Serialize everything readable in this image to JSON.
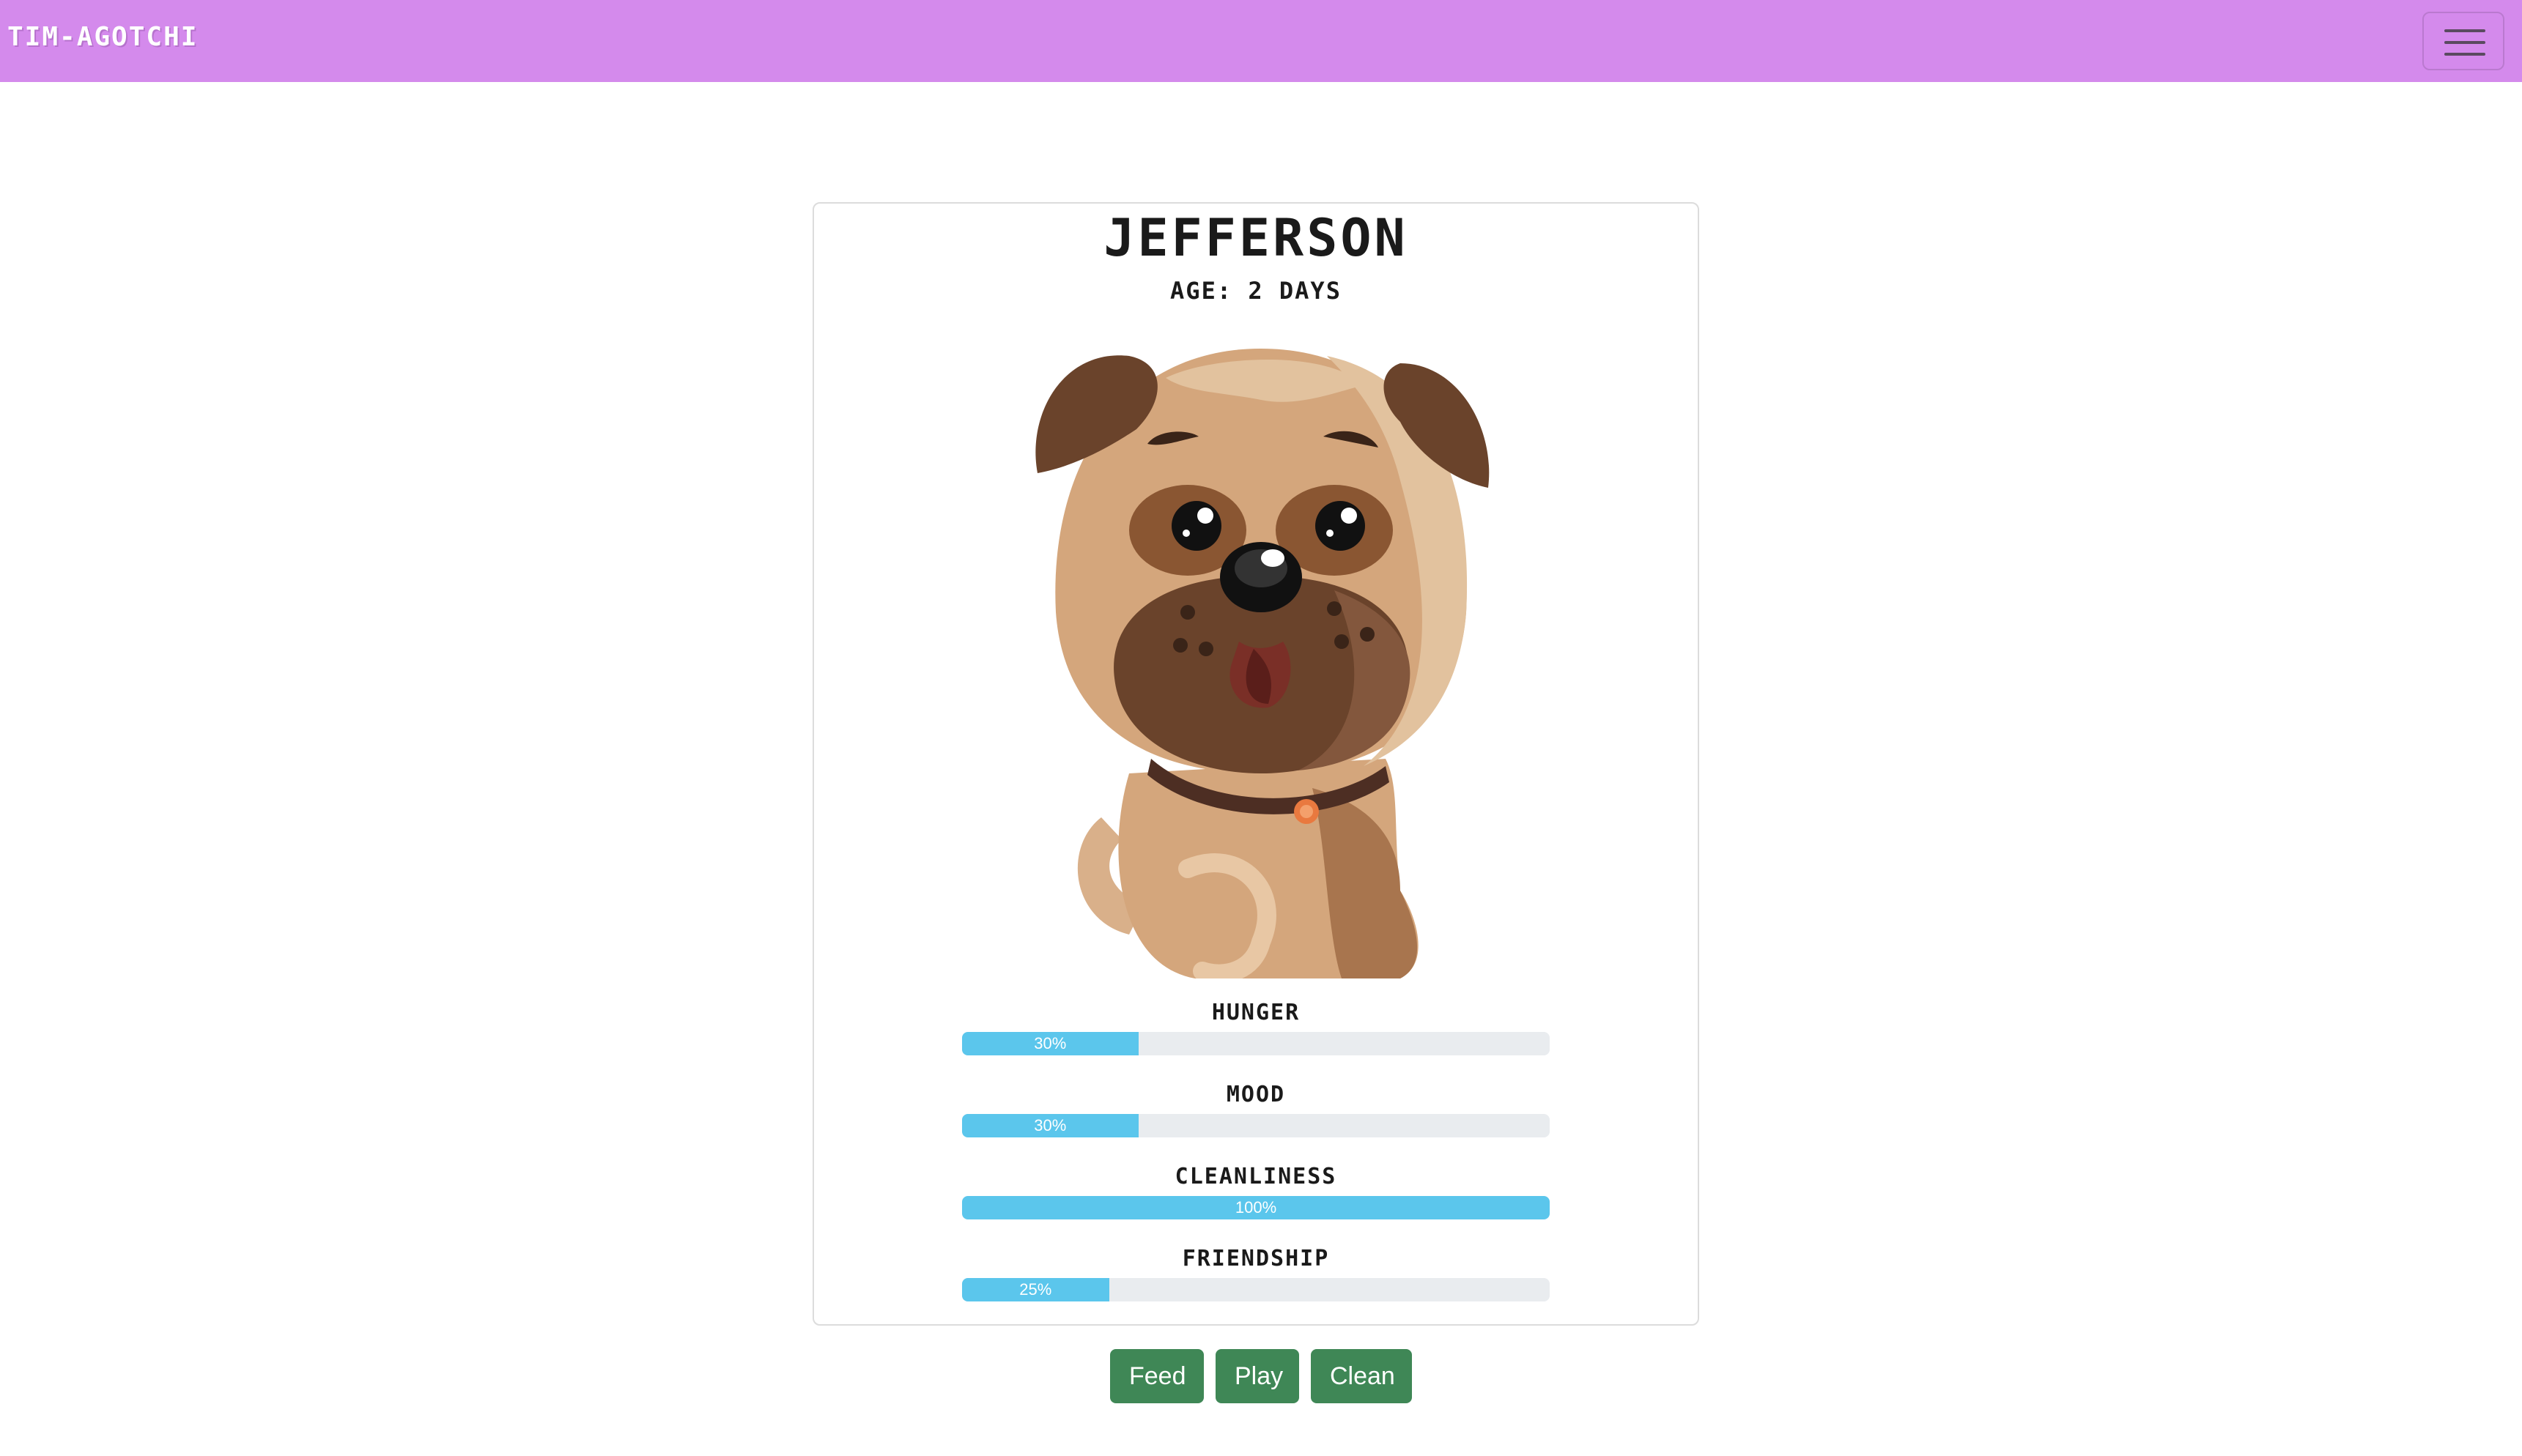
{
  "navbar": {
    "brand": "TIM-AGOTCHI",
    "background_color": "#d48aec",
    "menu_icon": "hamburger-menu-icon"
  },
  "pet": {
    "name": "JEFFERSON",
    "age": "AGE: 2 DAYS",
    "image": "pug-puppy-illustration"
  },
  "stats": [
    {
      "label": "HUNGER",
      "value": 30,
      "text": "30%"
    },
    {
      "label": "MOOD",
      "value": 30,
      "text": "30%"
    },
    {
      "label": "CLEANLINESS",
      "value": 100,
      "text": "100%"
    },
    {
      "label": "FRIENDSHIP",
      "value": 25,
      "text": "25%"
    }
  ],
  "actions": {
    "feed": "Feed",
    "play": "Play",
    "clean": "Clean",
    "button_color": "#3f8756"
  },
  "colors": {
    "progress_fill": "#5bc6ec",
    "progress_track": "#e9ecef"
  }
}
